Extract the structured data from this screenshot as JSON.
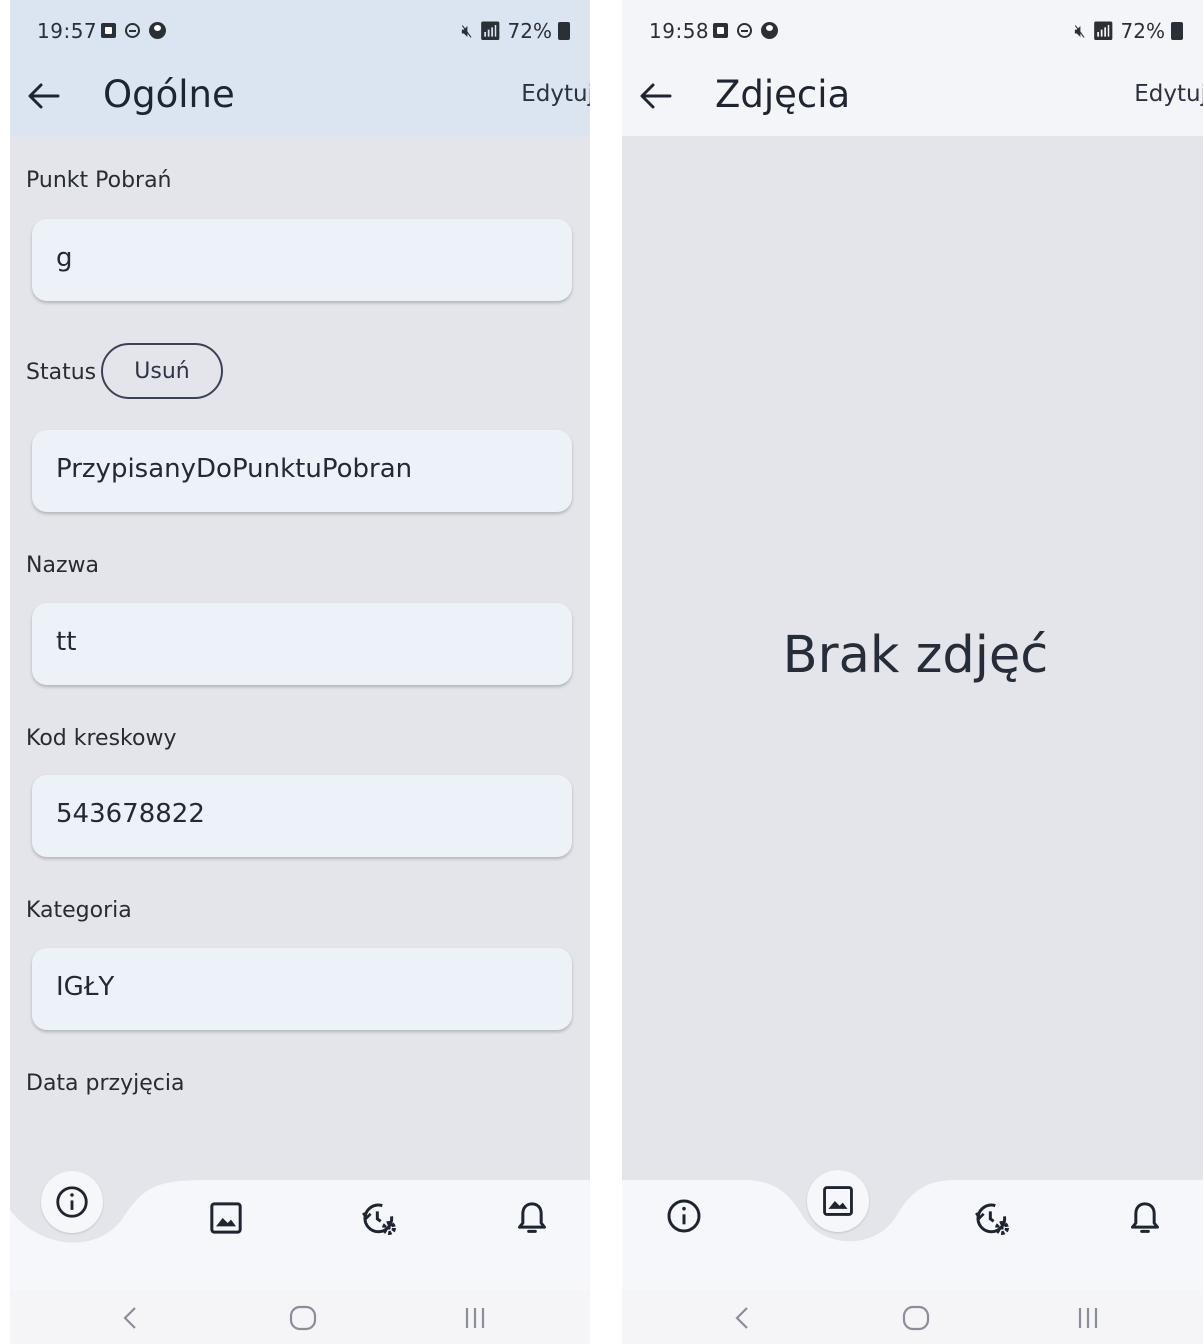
{
  "screens": [
    {
      "status_time": "19:57",
      "battery": "72%",
      "title": "Ogólne",
      "edit_label": "Edytuj",
      "fields": {
        "punkt_pobran": {
          "label": "Punkt Pobrań",
          "value": "g"
        },
        "status": {
          "label": "Status",
          "value": "PrzypisanyDoPunktuPobran",
          "remove_label": "Usuń"
        },
        "nazwa": {
          "label": "Nazwa",
          "value": "tt"
        },
        "kod_kreskowy": {
          "label": "Kod kreskowy",
          "value": "543678822"
        },
        "kategoria": {
          "label": "Kategoria",
          "value": "IGŁY"
        },
        "data_przyjecia": {
          "label": "Data przyjęcia"
        }
      },
      "active_tab": "info"
    },
    {
      "status_time": "19:58",
      "battery": "72%",
      "title": "Zdjęcia",
      "edit_label": "Edytuj",
      "empty_message": "Brak zdjęć",
      "active_tab": "photos"
    }
  ],
  "bottom_nav": [
    "info-icon",
    "image-icon",
    "history-settings-icon",
    "bell-icon"
  ],
  "system_nav": [
    "back-icon",
    "home-icon",
    "recents-icon"
  ],
  "colors": {
    "content_bg": "#e4e5ea",
    "field_bg": "#edf1f8",
    "appbar_left_bg": "#dce5f2",
    "text": "#1f2530"
  }
}
